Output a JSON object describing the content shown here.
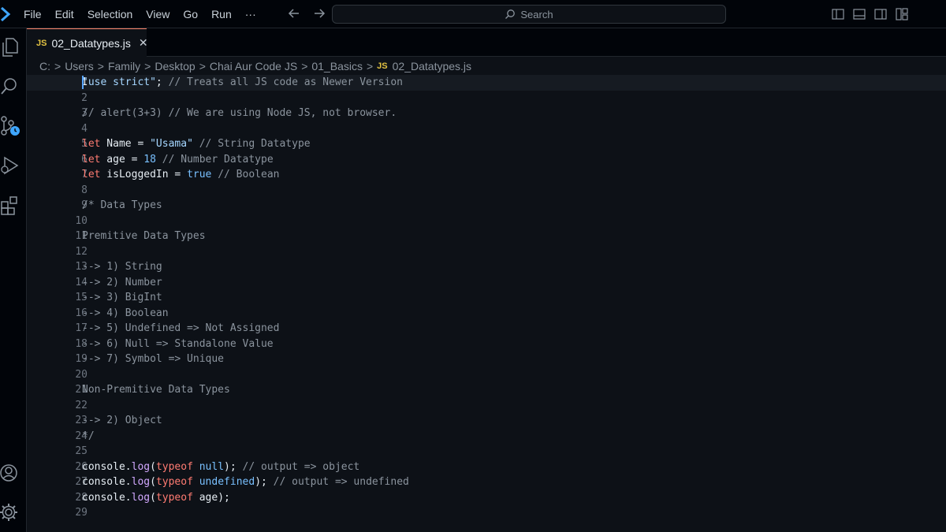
{
  "menu": [
    "File",
    "Edit",
    "Selection",
    "View",
    "Go",
    "Run",
    "···"
  ],
  "search": {
    "placeholder": "Search"
  },
  "tab": {
    "badge": "JS",
    "filename": "02_Datatypes.js",
    "close": "✕"
  },
  "breadcrumb": [
    "C:",
    "Users",
    "Family",
    "Desktop",
    "Chai Aur Code JS",
    "01_Basics"
  ],
  "breadcrumb_file": {
    "badge": "JS",
    "name": "02_Datatypes.js"
  },
  "colors": {
    "keyword": "#ff7b72",
    "string": "#a5d6ff",
    "comment": "#8b949e",
    "number": "#79c0ff",
    "function": "#d2a8ff",
    "background": "#0d1117"
  },
  "icons": [
    "vscode-logo-icon",
    "explorer-icon",
    "search-icon",
    "source-control-icon",
    "run-debug-icon",
    "extensions-icon",
    "account-icon",
    "settings-gear-icon"
  ],
  "current_line": 1,
  "lines": [
    [
      [
        "str",
        "\"use strict\""
      ],
      [
        "plain",
        "; "
      ],
      [
        "com",
        "// Treats all JS code as Newer Version"
      ]
    ],
    [],
    [
      [
        "com",
        "// alert(3+3) // We are using Node JS, not browser."
      ]
    ],
    [],
    [
      [
        "kw",
        "let"
      ],
      [
        "plain",
        " Name = "
      ],
      [
        "str",
        "\"Usama\""
      ],
      [
        "plain",
        " "
      ],
      [
        "com",
        "// String Datatype"
      ]
    ],
    [
      [
        "kw",
        "let"
      ],
      [
        "plain",
        " age = "
      ],
      [
        "num",
        "18"
      ],
      [
        "plain",
        " "
      ],
      [
        "com",
        "// Number Datatype"
      ]
    ],
    [
      [
        "kw",
        "let"
      ],
      [
        "plain",
        " isLoggedIn = "
      ],
      [
        "bool",
        "true"
      ],
      [
        "plain",
        " "
      ],
      [
        "com",
        "// Boolean"
      ]
    ],
    [],
    [
      [
        "com",
        "/* Data Types"
      ]
    ],
    [],
    [
      [
        "com",
        "Premitive Data Types"
      ]
    ],
    [],
    [
      [
        "com",
        "--> 1) String"
      ]
    ],
    [
      [
        "com",
        "--> 2) Number"
      ]
    ],
    [
      [
        "com",
        "--> 3) BigInt"
      ]
    ],
    [
      [
        "com",
        "--> 4) Boolean"
      ]
    ],
    [
      [
        "com",
        "--> 5) Undefined => Not Assigned"
      ]
    ],
    [
      [
        "com",
        "--> 6) Null => Standalone Value"
      ]
    ],
    [
      [
        "com",
        "--> 7) Symbol => Unique"
      ]
    ],
    [],
    [
      [
        "com",
        "Non-Premitive Data Types"
      ]
    ],
    [],
    [
      [
        "com",
        "--> 2) Object"
      ]
    ],
    [
      [
        "com",
        "*/"
      ]
    ],
    [],
    [
      [
        "plain",
        "console."
      ],
      [
        "fn",
        "log"
      ],
      [
        "plain",
        "("
      ],
      [
        "kw",
        "typeof"
      ],
      [
        "plain",
        " "
      ],
      [
        "bool",
        "null"
      ],
      [
        "plain",
        "); "
      ],
      [
        "com",
        "// output => object"
      ]
    ],
    [
      [
        "plain",
        "console."
      ],
      [
        "fn",
        "log"
      ],
      [
        "plain",
        "("
      ],
      [
        "kw",
        "typeof"
      ],
      [
        "plain",
        " "
      ],
      [
        "bool",
        "undefined"
      ],
      [
        "plain",
        "); "
      ],
      [
        "com",
        "// output => undefined"
      ]
    ],
    [
      [
        "plain",
        "console."
      ],
      [
        "fn",
        "log"
      ],
      [
        "plain",
        "("
      ],
      [
        "kw",
        "typeof"
      ],
      [
        "plain",
        " age);"
      ]
    ],
    []
  ]
}
